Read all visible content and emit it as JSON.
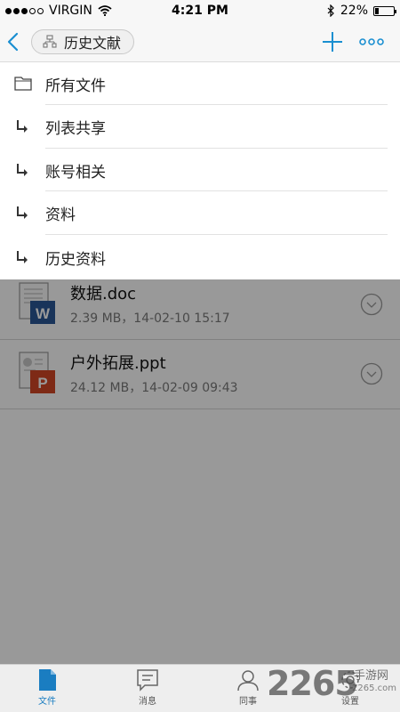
{
  "status_bar": {
    "carrier": "VIRGIN",
    "time": "4:21 PM",
    "battery": "22%",
    "battery_level": 0.22,
    "icons": [
      "signal-dots",
      "wifi-icon",
      "bluetooth-icon",
      "battery-icon"
    ]
  },
  "nav": {
    "title": "历史文献",
    "back_icon": "chevron-left-icon",
    "title_icon": "folder-tree-icon",
    "add_icon": "plus-icon",
    "more_icon": "more-dots-icon",
    "accent_color": "#1a8fd1"
  },
  "dropdown": {
    "items": [
      {
        "label": "所有文件",
        "icon": "folder-icon"
      },
      {
        "label": "列表共享",
        "icon": "subfolder-arrow-icon"
      },
      {
        "label": "账号相关",
        "icon": "subfolder-arrow-icon"
      },
      {
        "label": "资料",
        "icon": "subfolder-arrow-icon"
      },
      {
        "label": "历史资料",
        "icon": "subfolder-arrow-icon"
      }
    ]
  },
  "files": [
    {
      "name": "数据.doc",
      "meta": "2.39 MB，14-02-10 15:17",
      "icon": "word-file-icon",
      "badge": "W",
      "badge_color": "#2b5797"
    },
    {
      "name": "户外拓展.ppt",
      "meta": "24.12 MB，14-02-09  09:43",
      "icon": "powerpoint-file-icon",
      "badge": "P",
      "badge_color": "#d24726"
    }
  ],
  "tabs": [
    {
      "label": "文件",
      "icon": "file-icon",
      "active": true
    },
    {
      "label": "消息",
      "icon": "message-icon",
      "active": false
    },
    {
      "label": "同事",
      "icon": "person-icon",
      "active": false
    },
    {
      "label": "设置",
      "icon": "gear-icon",
      "active": false
    }
  ],
  "watermark": {
    "number": "2265",
    "text": "手游网",
    "url": "2265.com"
  }
}
